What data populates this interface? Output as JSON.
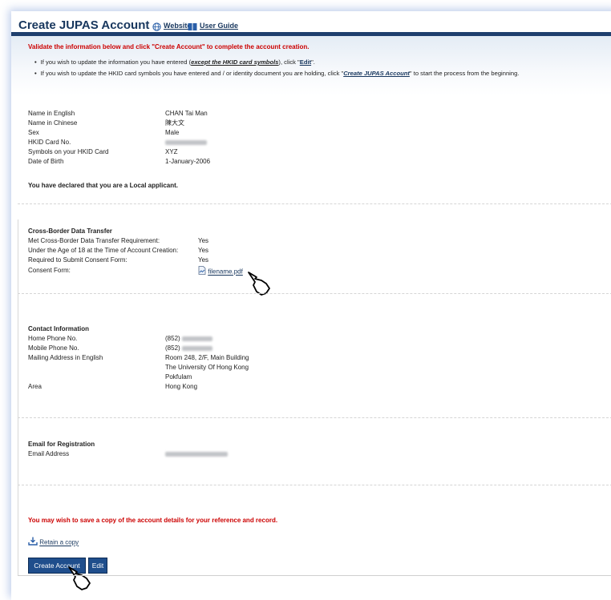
{
  "header": {
    "title": "Create JUPAS Account",
    "website_link": "Website",
    "userguide_link": "User Guide"
  },
  "intro": {
    "instruction": "Validate the information below and click \"Create Account\" to complete the account creation.",
    "bullet1_pre": "If you wish to update the information you have entered (",
    "bullet1_em": "except the HKID card symbols",
    "bullet1_mid": "), click \"",
    "bullet1_link": "Edit",
    "bullet1_post": "\".",
    "bullet2_pre": "If you wish to update the HKID card symbols you have entered and / or identity document you are holding, click \"",
    "bullet2_link": "Create JUPAS Account",
    "bullet2_post": "\" to start the process from the beginning."
  },
  "personal": {
    "name_en_label": "Name in English",
    "name_en_value": "CHAN Tai Man",
    "name_zh_label": "Name in Chinese",
    "name_zh_value": "陳大文",
    "sex_label": "Sex",
    "sex_value": "Male",
    "hkid_label": "HKID Card No.",
    "symbols_label": "Symbols on your HKID Card",
    "symbols_value": "XYZ",
    "dob_label": "Date of Birth",
    "dob_value": "1-January-2006",
    "declaration": "You have declared that you are a Local applicant."
  },
  "crossborder": {
    "heading": "Cross-Border Data Transfer",
    "met_label": "Met Cross-Border Data Transfer Requirement:",
    "met_value": "Yes",
    "under18_label": "Under the Age of 18 at the Time of Account Creation:",
    "under18_value": "Yes",
    "consent_req_label": "Required to Submit Consent Form:",
    "consent_req_value": "Yes",
    "consent_form_label": "Consent Form:",
    "consent_form_file": "filename.pdf"
  },
  "contact": {
    "heading": "Contact Information",
    "home_label": "Home Phone No.",
    "home_prefix": "(852)",
    "mobile_label": "Mobile Phone No.",
    "mobile_prefix": "(852)",
    "mail_label": "Mailing Address in English",
    "mail_line1": "Room 248, 2/F, Main Building",
    "mail_line2": "The University Of Hong Kong",
    "mail_line3": "Pokfulam",
    "area_label": "Area",
    "area_value": "Hong Kong"
  },
  "email": {
    "heading": "Email for Registration",
    "address_label": "Email Address"
  },
  "footer": {
    "save_note": "You may wish to save a copy of the account details for your reference and record.",
    "retain_link": "Retain a copy",
    "create_button": "Create Account",
    "edit_button": "Edit"
  },
  "icons": {
    "website": "globe-icon",
    "userguide": "book-icon",
    "pdf": "pdf-file-icon",
    "download": "download-icon",
    "cursor": "hand-pointer-icon"
  },
  "colors": {
    "brand": "#17365d",
    "alert": "#cc0000",
    "button": "#1f4e8c"
  }
}
